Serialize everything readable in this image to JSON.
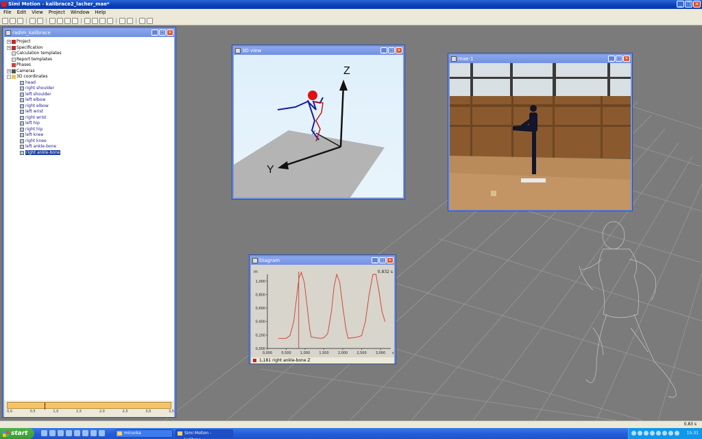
{
  "app": {
    "title": "Simi Motion - kalibrace2_lacher_mae*",
    "menu": [
      "File",
      "Edit",
      "View",
      "Project",
      "Window",
      "Help"
    ]
  },
  "tree_window": {
    "title": "radim_kalibrace",
    "items": [
      {
        "label": "Project",
        "toggle": "+"
      },
      {
        "label": "Specification",
        "toggle": "+"
      },
      {
        "label": "Calculation templates",
        "toggle": ""
      },
      {
        "label": "Report templates",
        "toggle": ""
      },
      {
        "label": "Phases",
        "toggle": ""
      },
      {
        "label": "Cameras",
        "toggle": "+"
      },
      {
        "label": "3D coordinates",
        "toggle": "-"
      }
    ],
    "children": [
      "head",
      "right shoulder",
      "left shoulder",
      "left elbow",
      "right elbow",
      "left wrist",
      "right wrist",
      "left hip",
      "right hip",
      "left knee",
      "right knee",
      "left ankle-bone",
      "right ankle-bone"
    ],
    "selected_child": "right ankle-bone",
    "timeline_ticks": [
      "0,0",
      "0,5",
      "1,0",
      "1,5",
      "2,0",
      "2,5",
      "3,0",
      "3,5"
    ]
  },
  "view3d": {
    "title": "3D view",
    "axis_z": "Z",
    "axis_y": "Y",
    "axis_x": "X"
  },
  "camera": {
    "title": "mae-1"
  },
  "diagram": {
    "title": "Diagram",
    "time_readout": "0,832 s",
    "legend": "1,181  right ankle-bone Z"
  },
  "chart_data": {
    "type": "line",
    "title": "",
    "xlabel": "s",
    "ylabel": "m",
    "xlim": [
      0,
      3.2
    ],
    "ylim": [
      0,
      1.1
    ],
    "x_ticks": [
      "0,000",
      "0,500",
      "1,000",
      "1,500",
      "2,000",
      "2,500",
      "3,000"
    ],
    "y_ticks": [
      "0,000",
      "0,200",
      "0,400",
      "0,600",
      "0,800",
      "1,000"
    ],
    "cursor_x": 0.832,
    "series": [
      {
        "color": "#d03a2a",
        "x": [
          0.3,
          0.5,
          0.6,
          0.7,
          0.78,
          0.84,
          0.9,
          0.98,
          1.06,
          1.12,
          1.16,
          1.4,
          1.5,
          1.6,
          1.7,
          1.77,
          1.84,
          1.92,
          2.0,
          2.08,
          2.14,
          2.4,
          2.5,
          2.6,
          2.7,
          2.8,
          2.88,
          2.96,
          3.04,
          3.12
        ],
        "values": [
          0.15,
          0.15,
          0.19,
          0.4,
          0.78,
          1.05,
          1.13,
          0.98,
          0.6,
          0.3,
          0.17,
          0.15,
          0.16,
          0.22,
          0.55,
          0.92,
          1.1,
          0.98,
          0.62,
          0.3,
          0.15,
          0.17,
          0.19,
          0.4,
          0.8,
          1.1,
          1.1,
          0.85,
          0.55,
          0.4
        ]
      }
    ]
  },
  "statusbar": {
    "time": "0,83 s"
  },
  "taskbar": {
    "start": "start",
    "tasks": [
      "mirunka",
      "Simi Motion - kalibrac..."
    ],
    "clock": "15:31"
  }
}
